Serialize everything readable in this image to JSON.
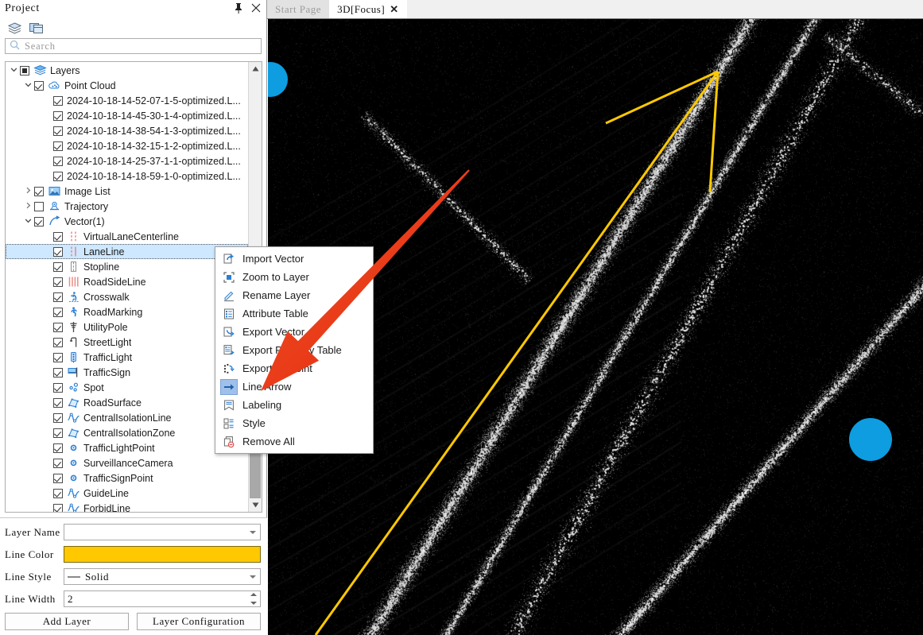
{
  "panel": {
    "title": "Project",
    "pin_icon": "pin-icon",
    "close_icon": "close-icon",
    "toolbar_icons": [
      "layers-stack-icon",
      "windows-tile-icon"
    ],
    "search": {
      "placeholder": "Search",
      "icon": "search-icon",
      "value": ""
    }
  },
  "tabs": [
    {
      "label": "Start Page",
      "active": false,
      "closable": false
    },
    {
      "label": "3D[Focus]",
      "active": true,
      "closable": true,
      "close_icon": "close-icon"
    }
  ],
  "tree": [
    {
      "label": "Layers",
      "indent": 0,
      "twisty": "down",
      "checkbox": "partial",
      "icon": "layers-icon"
    },
    {
      "label": "Point Cloud",
      "indent": 1,
      "twisty": "down",
      "checkbox": "on",
      "icon": "point-cloud-icon"
    },
    {
      "label": "2024-10-18-14-52-07-1-5-optimized.L...",
      "indent": 2,
      "twisty": "none",
      "checkbox": "on",
      "icon": "none"
    },
    {
      "label": "2024-10-18-14-45-30-1-4-optimized.L...",
      "indent": 2,
      "twisty": "none",
      "checkbox": "on",
      "icon": "none"
    },
    {
      "label": "2024-10-18-14-38-54-1-3-optimized.L...",
      "indent": 2,
      "twisty": "none",
      "checkbox": "on",
      "icon": "none"
    },
    {
      "label": "2024-10-18-14-32-15-1-2-optimized.L...",
      "indent": 2,
      "twisty": "none",
      "checkbox": "on",
      "icon": "none"
    },
    {
      "label": "2024-10-18-14-25-37-1-1-optimized.L...",
      "indent": 2,
      "twisty": "none",
      "checkbox": "on",
      "icon": "none"
    },
    {
      "label": "2024-10-18-14-18-59-1-0-optimized.L...",
      "indent": 2,
      "twisty": "none",
      "checkbox": "on",
      "icon": "none"
    },
    {
      "label": "Image List",
      "indent": 1,
      "twisty": "right",
      "checkbox": "on",
      "icon": "image-icon"
    },
    {
      "label": "Trajectory",
      "indent": 1,
      "twisty": "right",
      "checkbox": "off",
      "icon": "trajectory-icon"
    },
    {
      "label": "Vector(1)",
      "indent": 1,
      "twisty": "down",
      "checkbox": "on",
      "icon": "vector-icon"
    },
    {
      "label": "VirtualLaneCenterline",
      "indent": 2,
      "twisty": "none",
      "checkbox": "on",
      "icon": "dashed-line-icon"
    },
    {
      "label": "LaneLine",
      "indent": 2,
      "twisty": "none",
      "checkbox": "on",
      "icon": "lane-line-icon",
      "selected": true
    },
    {
      "label": "Stopline",
      "indent": 2,
      "twisty": "none",
      "checkbox": "on",
      "icon": "stop-line-icon"
    },
    {
      "label": "RoadSideLine",
      "indent": 2,
      "twisty": "none",
      "checkbox": "on",
      "icon": "road-side-line-icon"
    },
    {
      "label": "Crosswalk",
      "indent": 2,
      "twisty": "none",
      "checkbox": "on",
      "icon": "crosswalk-icon"
    },
    {
      "label": "RoadMarking",
      "indent": 2,
      "twisty": "none",
      "checkbox": "on",
      "icon": "road-marking-icon"
    },
    {
      "label": "UtilityPole",
      "indent": 2,
      "twisty": "none",
      "checkbox": "on",
      "icon": "utility-pole-icon"
    },
    {
      "label": "StreetLight",
      "indent": 2,
      "twisty": "none",
      "checkbox": "on",
      "icon": "street-light-icon"
    },
    {
      "label": "TrafficLight",
      "indent": 2,
      "twisty": "none",
      "checkbox": "on",
      "icon": "traffic-light-icon"
    },
    {
      "label": "TrafficSign",
      "indent": 2,
      "twisty": "none",
      "checkbox": "on",
      "icon": "traffic-sign-icon"
    },
    {
      "label": "Spot",
      "indent": 2,
      "twisty": "none",
      "checkbox": "on",
      "icon": "spot-icon"
    },
    {
      "label": "RoadSurface",
      "indent": 2,
      "twisty": "none",
      "checkbox": "on",
      "icon": "road-surface-icon"
    },
    {
      "label": "CentralIsolationLine",
      "indent": 2,
      "twisty": "none",
      "checkbox": "on",
      "icon": "polyline-icon"
    },
    {
      "label": "CentralIsolationZone",
      "indent": 2,
      "twisty": "none",
      "checkbox": "on",
      "icon": "road-surface-icon"
    },
    {
      "label": "TrafficLightPoint",
      "indent": 2,
      "twisty": "none",
      "checkbox": "on",
      "icon": "point-icon"
    },
    {
      "label": "SurveillanceCamera",
      "indent": 2,
      "twisty": "none",
      "checkbox": "on",
      "icon": "point-icon"
    },
    {
      "label": "TrafficSignPoint",
      "indent": 2,
      "twisty": "none",
      "checkbox": "on",
      "icon": "point-icon"
    },
    {
      "label": "GuideLine",
      "indent": 2,
      "twisty": "none",
      "checkbox": "on",
      "icon": "polyline-icon"
    },
    {
      "label": "ForbidLine",
      "indent": 2,
      "twisty": "none",
      "checkbox": "on",
      "icon": "polyline-icon"
    }
  ],
  "context_menu": {
    "items": [
      {
        "label": "Import Vector",
        "icon": "import-icon",
        "highlighted": false
      },
      {
        "label": "Zoom to Layer",
        "icon": "zoom-to-layer-icon",
        "highlighted": false
      },
      {
        "label": "Rename Layer",
        "icon": "pencil-icon",
        "highlighted": false
      },
      {
        "label": "Attribute Table",
        "icon": "table-icon",
        "highlighted": false
      },
      {
        "label": "Export Vector",
        "icon": "export-icon",
        "highlighted": false
      },
      {
        "label": "Export Property Table",
        "icon": "export-table-icon",
        "highlighted": false
      },
      {
        "label": "Export To Point",
        "icon": "export-to-point-icon",
        "highlighted": false
      },
      {
        "label": "Line Arrow",
        "icon": "arrow-right-icon",
        "highlighted": true
      },
      {
        "label": "Labeling",
        "icon": "label-tag-icon",
        "highlighted": false
      },
      {
        "label": "Style",
        "icon": "style-icon",
        "highlighted": false
      },
      {
        "label": "Remove All",
        "icon": "remove-all-icon",
        "highlighted": false
      }
    ]
  },
  "properties": {
    "layer_name": {
      "label": "Layer Name",
      "value": ""
    },
    "line_color": {
      "label": "Line Color",
      "value": "#FFC800"
    },
    "line_style": {
      "label": "Line Style",
      "value": "Solid"
    },
    "line_width": {
      "label": "Line Width",
      "value": "2"
    },
    "add_layer_button": "Add Layer",
    "layer_configuration_button": "Layer Configuration"
  },
  "viewport": {
    "background_color": "#000000",
    "point_color": "#ffffff",
    "lane_line_color": "#FFC800",
    "marker_color": "#0D9DE0",
    "callout_arrow_color": "#E8341C"
  }
}
